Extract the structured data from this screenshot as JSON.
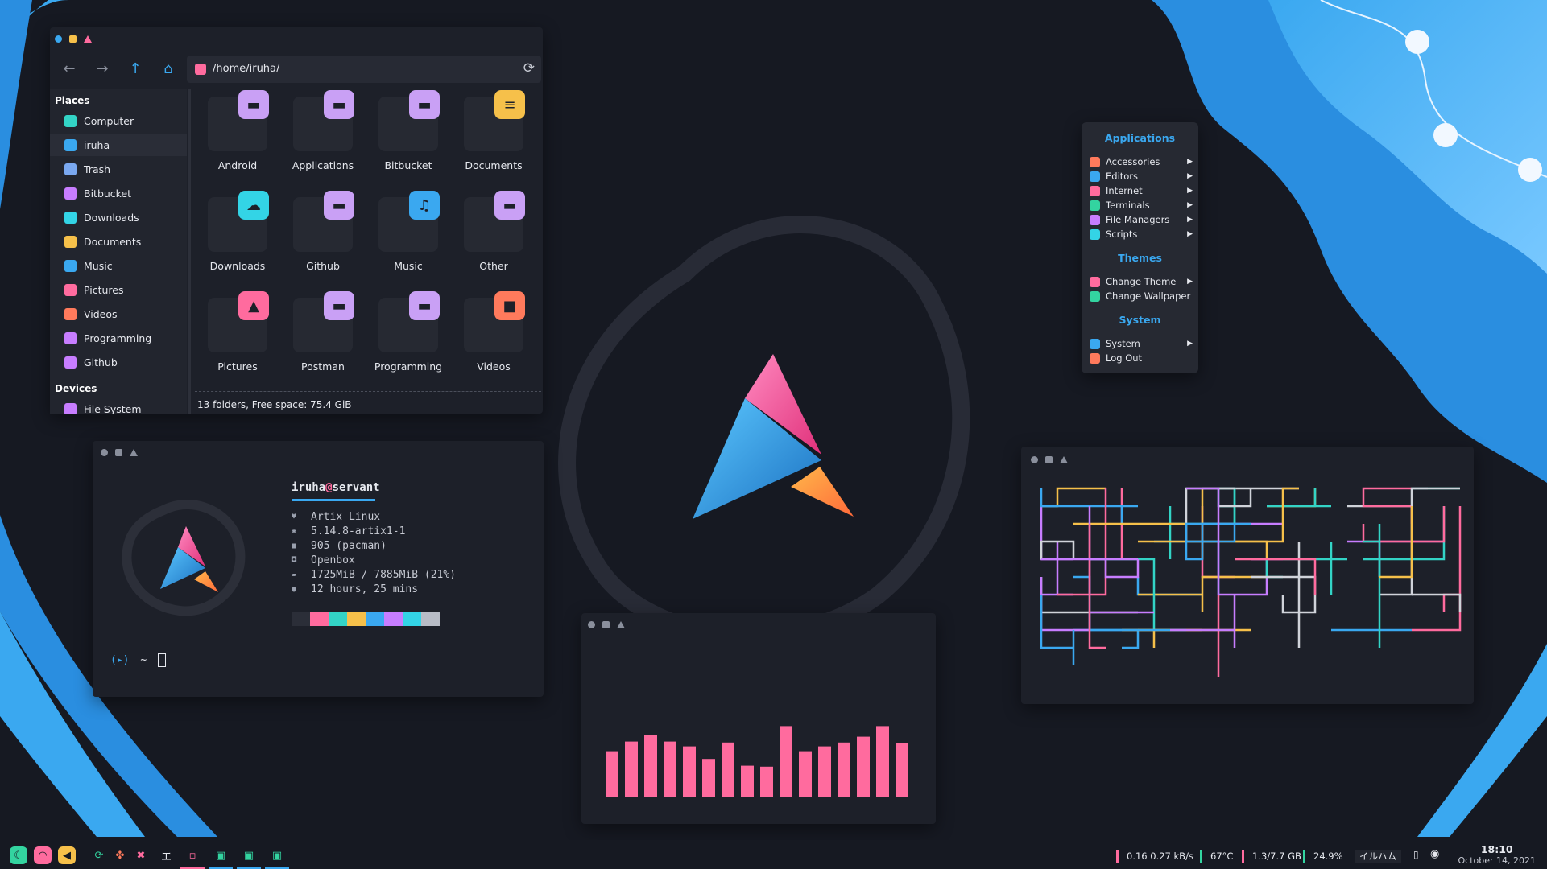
{
  "file_manager": {
    "path": "/home/iruha/",
    "places_header": "Places",
    "devices_header": "Devices",
    "places": [
      {
        "label": "Computer",
        "icon": "monitor-icon",
        "color": "#33d4c6",
        "selected": false
      },
      {
        "label": "iruha",
        "icon": "home-icon",
        "color": "#3aa8f0",
        "selected": true
      },
      {
        "label": "Trash",
        "icon": "trash-icon",
        "color": "#7aa8f0",
        "selected": false
      },
      {
        "label": "Bitbucket",
        "icon": "folder-icon",
        "color": "#c77dff",
        "selected": false
      },
      {
        "label": "Downloads",
        "icon": "download-icon",
        "color": "#33d4e6",
        "selected": false
      },
      {
        "label": "Documents",
        "icon": "document-icon",
        "color": "#f6c04a",
        "selected": false
      },
      {
        "label": "Music",
        "icon": "music-icon",
        "color": "#3aa8f0",
        "selected": false
      },
      {
        "label": "Pictures",
        "icon": "image-icon",
        "color": "#ff6b9e",
        "selected": false
      },
      {
        "label": "Videos",
        "icon": "video-icon",
        "color": "#ff7a5c",
        "selected": false
      },
      {
        "label": "Programming",
        "icon": "folder-icon",
        "color": "#c77dff",
        "selected": false
      },
      {
        "label": "Github",
        "icon": "folder-icon",
        "color": "#c77dff",
        "selected": false
      }
    ],
    "devices": [
      {
        "label": "File System",
        "icon": "drive-icon",
        "color": "#c77dff"
      }
    ],
    "folders": [
      {
        "name": "Android",
        "glyph": "▬",
        "color": "#c9a0f5"
      },
      {
        "name": "Applications",
        "glyph": "▬",
        "color": "#c9a0f5"
      },
      {
        "name": "Bitbucket",
        "glyph": "▬",
        "color": "#c9a0f5"
      },
      {
        "name": "Documents",
        "glyph": "≡",
        "color": "#f6c04a"
      },
      {
        "name": "Downloads",
        "glyph": "☁",
        "color": "#33d4e6"
      },
      {
        "name": "Github",
        "glyph": "▬",
        "color": "#c9a0f5"
      },
      {
        "name": "Music",
        "glyph": "♫",
        "color": "#3aa8f0"
      },
      {
        "name": "Other",
        "glyph": "▬",
        "color": "#c9a0f5"
      },
      {
        "name": "Pictures",
        "glyph": "▲",
        "color": "#ff6b9e"
      },
      {
        "name": "Postman",
        "glyph": "▬",
        "color": "#c9a0f5"
      },
      {
        "name": "Programming",
        "glyph": "▬",
        "color": "#c9a0f5"
      },
      {
        "name": "Videos",
        "glyph": "■",
        "color": "#ff7a5c"
      }
    ],
    "status": "13 folders, Free space: 75.4 GiB"
  },
  "fetch": {
    "user": "iruha",
    "at": "@",
    "host": "servant",
    "lines": [
      {
        "icon": "heart-icon",
        "glyph": "♥",
        "text": "Artix Linux"
      },
      {
        "icon": "gear-icon",
        "glyph": "✱",
        "text": "5.14.8-artix1-1"
      },
      {
        "icon": "package-icon",
        "glyph": "■",
        "text": "905 (pacman)"
      },
      {
        "icon": "window-icon",
        "glyph": "◘",
        "text": "Openbox"
      },
      {
        "icon": "memory-icon",
        "glyph": "▰",
        "text": "1725MiB / 7885MiB (21%)"
      },
      {
        "icon": "bulb-icon",
        "glyph": "●",
        "text": "12 hours, 25 mins"
      }
    ],
    "palette": [
      "#2b2e38",
      "#ff6b9e",
      "#33d4c6",
      "#f6c04a",
      "#3aa8f0",
      "#c77dff",
      "#33d4e6",
      "#b8bcc6"
    ],
    "prompt_symbol": "(▸)",
    "prompt_dir": "~"
  },
  "menu": {
    "sections": [
      {
        "title": "Applications",
        "items": [
          {
            "label": "Accessories",
            "color": "#ff7a5c",
            "submenu": true
          },
          {
            "label": "Editors",
            "color": "#3aa8f0",
            "submenu": true
          },
          {
            "label": "Internet",
            "color": "#ff6b9e",
            "submenu": true
          },
          {
            "label": "Terminals",
            "color": "#33d4a0",
            "submenu": true
          },
          {
            "label": "File Managers",
            "color": "#c77dff",
            "submenu": true
          },
          {
            "label": "Scripts",
            "color": "#33d4e6",
            "submenu": true
          }
        ]
      },
      {
        "title": "Themes",
        "items": [
          {
            "label": "Change Theme",
            "color": "#ff6b9e",
            "submenu": true
          },
          {
            "label": "Change Wallpaper",
            "color": "#33d4a0",
            "submenu": false
          }
        ]
      },
      {
        "title": "System",
        "items": [
          {
            "label": "System",
            "color": "#3aa8f0",
            "submenu": true
          },
          {
            "label": "Log Out",
            "color": "#ff7a5c",
            "submenu": false
          }
        ]
      }
    ]
  },
  "visualizer": {
    "levels": [
      0.47,
      0.57,
      0.64,
      0.57,
      0.52,
      0.39,
      0.56,
      0.32,
      0.31,
      0.73,
      0.47,
      0.52,
      0.56,
      0.62,
      0.73,
      0.55
    ],
    "color": "#ff6b9e"
  },
  "taskbar": {
    "launchers": [
      {
        "name": "launcher-icon",
        "glyph": "☾",
        "color": "#33d4a0"
      },
      {
        "name": "wifi-icon",
        "glyph": "◠",
        "color": "#ff6b9e"
      },
      {
        "name": "volume-icon",
        "glyph": "◀",
        "color": "#f6c04a"
      }
    ],
    "tray": [
      {
        "name": "sync-icon",
        "glyph": "⟳",
        "color": "#33d4a0"
      },
      {
        "name": "pinwheel-icon",
        "glyph": "✤",
        "color": "#ff7a5c"
      },
      {
        "name": "puzzle-icon",
        "glyph": "✖",
        "color": "#ff6b9e"
      }
    ],
    "workspace_label": "エ",
    "workspaces": [
      {
        "glyph": "▫",
        "color": "#ff6b9e"
      },
      {
        "glyph": "▣",
        "color": "#33d4a0"
      },
      {
        "glyph": "▣",
        "color": "#33d4a0"
      },
      {
        "glyph": "▣",
        "color": "#33d4a0"
      }
    ],
    "stats": [
      {
        "text": "0.16  0.27 kB/s",
        "color": "#ff6b9e"
      },
      {
        "text": "67°C",
        "color": "#33d4a0"
      },
      {
        "text": "1.3/7.7 GB",
        "color": "#ff6b9e"
      },
      {
        "text": "24.9%",
        "color": "#33d4a0"
      }
    ],
    "kana": "イルハム",
    "time": "18:10",
    "date": "October 14, 2021"
  }
}
